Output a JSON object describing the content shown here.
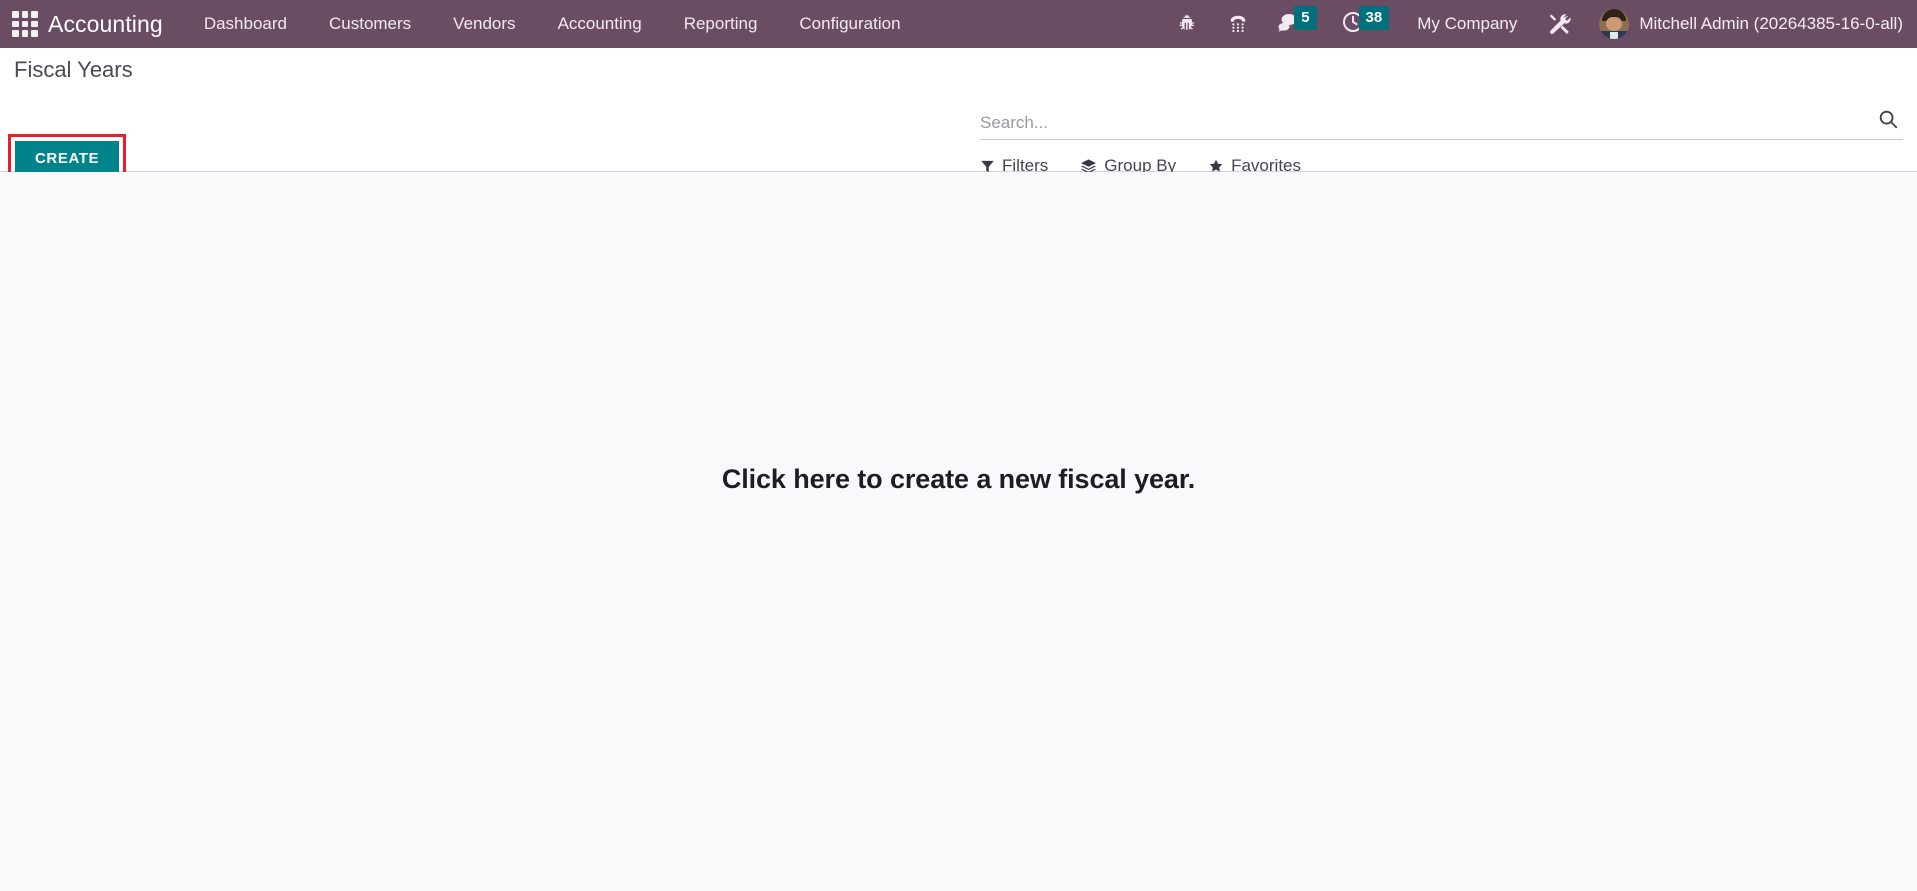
{
  "navbar": {
    "apps_icon": "apps-grid-icon",
    "brand": "Accounting",
    "menu": [
      {
        "label": "Dashboard"
      },
      {
        "label": "Customers"
      },
      {
        "label": "Vendors"
      },
      {
        "label": "Accounting"
      },
      {
        "label": "Reporting"
      },
      {
        "label": "Configuration"
      }
    ],
    "systray": {
      "bug_icon": "bug-icon",
      "dialpad_icon": "dialpad-icon",
      "messages_icon": "chat-bubble-icon",
      "messages_count": "5",
      "activities_icon": "clock-icon",
      "activities_count": "38",
      "company": "My Company",
      "debug_icon": "wrench-screwdriver-icon",
      "avatar": "user-avatar",
      "username": "Mitchell Admin (20264385-16-0-all)"
    }
  },
  "control_panel": {
    "breadcrumb": "Fiscal Years",
    "create_label": "CREATE",
    "highlight_color": "#ee1c25",
    "button_color": "#00838a"
  },
  "search": {
    "placeholder": "Search...",
    "value": "",
    "search_icon": "magnifier-icon",
    "filters": [
      {
        "label": "Filters",
        "icon": "funnel-icon"
      },
      {
        "label": "Group By",
        "icon": "layers-icon"
      },
      {
        "label": "Favorites",
        "icon": "star-icon"
      }
    ]
  },
  "content": {
    "empty_message": "Click here to create a new fiscal year."
  },
  "theme": {
    "navbar_bg": "#6b4d63",
    "accent_teal": "#00838a",
    "badge_teal": "#00707a",
    "content_bg": "#f9f9fc"
  }
}
